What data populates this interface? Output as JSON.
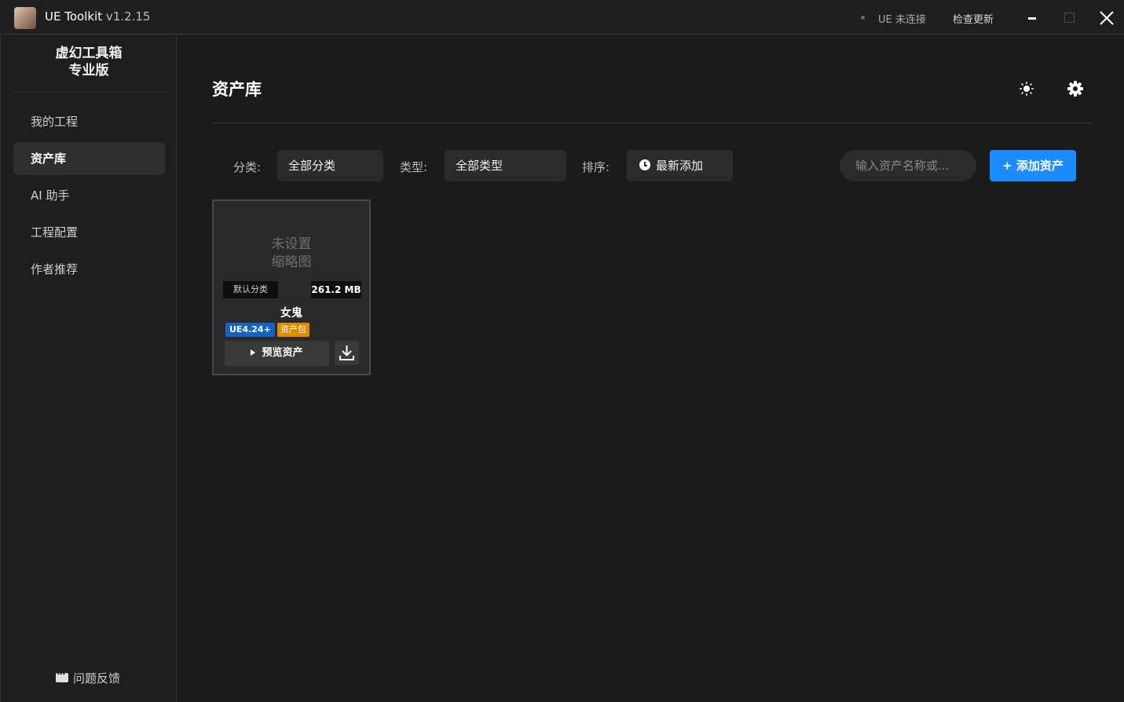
{
  "window": {
    "app_name": "UE Toolkit",
    "version": "v1.2.15",
    "connection_status": "UE 未连接",
    "check_update": "检查更新"
  },
  "sidebar": {
    "brand_line1": "虚幻工具箱",
    "brand_line2": "专业版",
    "items": [
      {
        "label": "我的工程",
        "active": false
      },
      {
        "label": "资产库",
        "active": true
      },
      {
        "label": "AI 助手",
        "active": false
      },
      {
        "label": "工程配置",
        "active": false
      },
      {
        "label": "作者推荐",
        "active": false
      }
    ],
    "feedback": "问题反馈"
  },
  "main": {
    "title": "资产库",
    "filters": {
      "category_label": "分类:",
      "category_value": "全部分类",
      "type_label": "类型:",
      "type_value": "全部类型",
      "sort_label": "排序:",
      "sort_value": "最新添加"
    },
    "search": {
      "placeholder": "输入资产名称或..."
    },
    "add_button": "+ 添加资产"
  },
  "assets": [
    {
      "thumbnail_line1": "未设置",
      "thumbnail_line2": "缩略图",
      "category": "默认分类",
      "size": "261.2 MB",
      "name": "女鬼",
      "engine_tag": "UE4.24+",
      "type_tag": "资产包",
      "preview_label": "预览资产"
    }
  ],
  "colors": {
    "accent": "#1a8cff",
    "engine_tag": "#1565c0",
    "type_tag": "#e08a00",
    "background": "#1b1b1b"
  }
}
